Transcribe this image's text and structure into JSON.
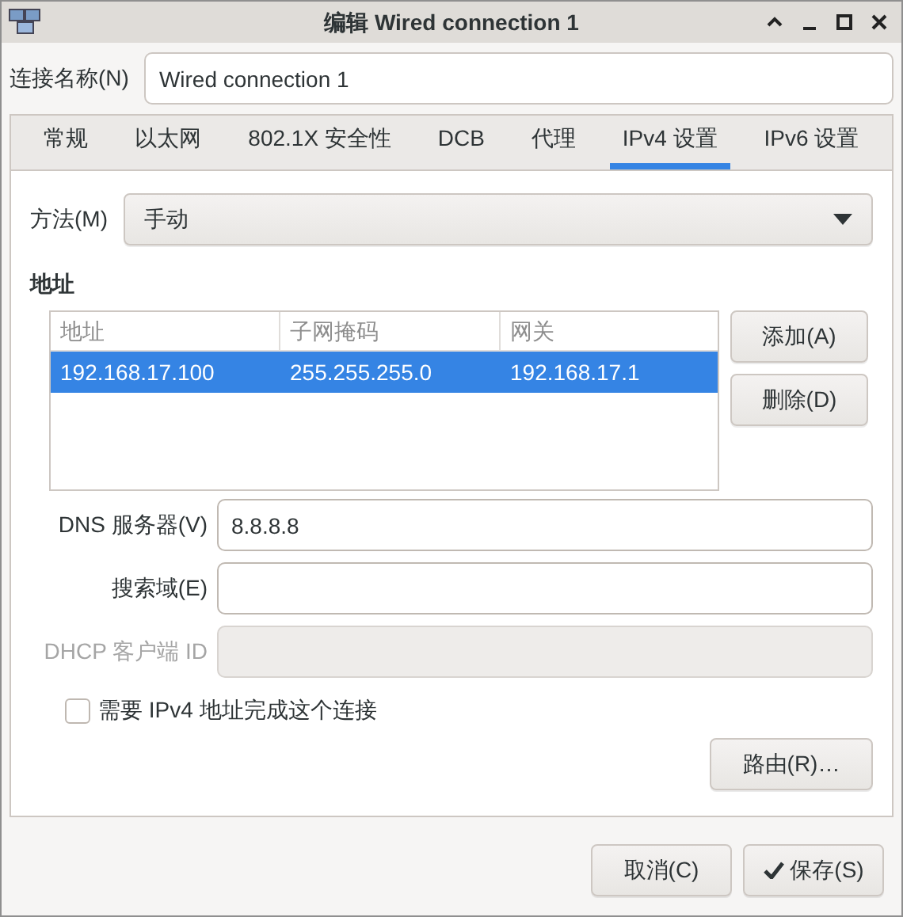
{
  "window": {
    "title": "编辑 Wired connection 1"
  },
  "connection_name": {
    "label": "连接名称(N)",
    "value": "Wired connection 1"
  },
  "tabs": [
    {
      "label": "常规",
      "selected": false
    },
    {
      "label": "以太网",
      "selected": false
    },
    {
      "label": "802.1X 安全性",
      "selected": false
    },
    {
      "label": "DCB",
      "selected": false
    },
    {
      "label": "代理",
      "selected": false
    },
    {
      "label": "IPv4 设置",
      "selected": true
    },
    {
      "label": "IPv6 设置",
      "selected": false
    }
  ],
  "method": {
    "label": "方法(M)",
    "value": "手动"
  },
  "addresses": {
    "heading": "地址",
    "columns": [
      "地址",
      "子网掩码",
      "网关"
    ],
    "rows": [
      {
        "cells": [
          "192.168.17.100",
          "255.255.255.0",
          "192.168.17.1"
        ],
        "selected": true
      }
    ],
    "buttons": [
      "添加(A)",
      "删除(D)"
    ]
  },
  "fields": [
    {
      "label": "DNS 服务器(V)",
      "value": "8.8.8.8",
      "disabled": false
    },
    {
      "label": "搜索域(E)",
      "disabled": false
    },
    {
      "label": "DHCP 客户端 ID",
      "disabled": true
    }
  ],
  "require_ipv4": {
    "label": "需要 IPv4 地址完成这个连接",
    "checked": false
  },
  "routes_button": "路由(R)…",
  "footer_buttons": [
    {
      "label": "取消(C)",
      "kind": "plain"
    },
    {
      "label": "保存(S)",
      "kind": "check"
    }
  ]
}
